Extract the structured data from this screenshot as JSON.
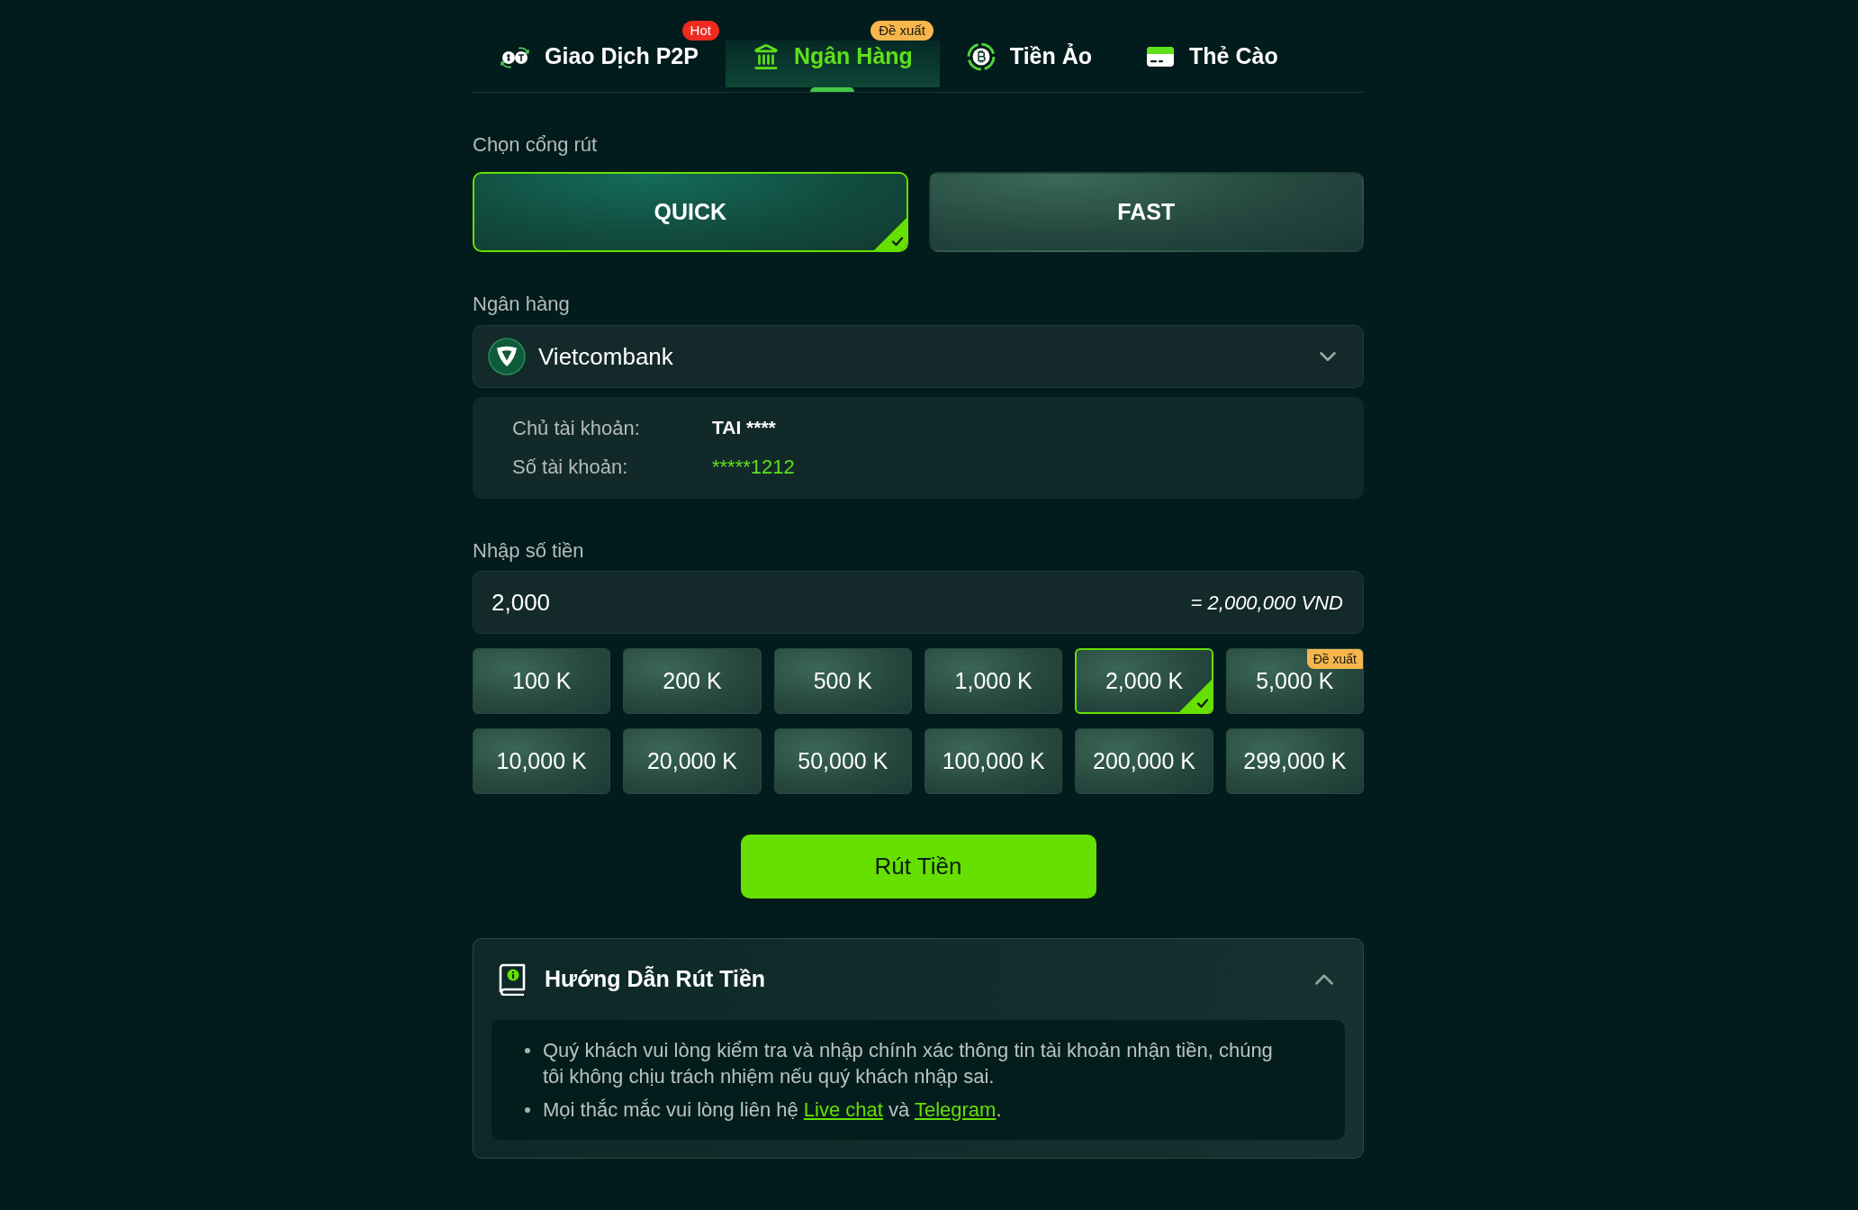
{
  "tabs": [
    {
      "label": "Giao Dịch P2P",
      "selected": false,
      "badge": {
        "text": "Hot",
        "color": "#ef2a1f"
      }
    },
    {
      "label": "Ngân Hàng",
      "selected": true,
      "badge": {
        "text": "Đề xuất",
        "color": "#f7b64d"
      }
    },
    {
      "label": "Tiền Ảo",
      "selected": false
    },
    {
      "label": "Thẻ Cào",
      "selected": false
    }
  ],
  "withdraw_gate": {
    "label": "Chọn cổng rút",
    "options": [
      {
        "label": "QUICK",
        "selected": true
      },
      {
        "label": "FAST",
        "selected": false
      }
    ]
  },
  "bank": {
    "label": "Ngân hàng",
    "value": "Vietcombank"
  },
  "account_info": [
    {
      "label": "Chủ tài khoản:",
      "value": "TAI ****",
      "kind": "plain"
    },
    {
      "label": "Số tài khoản:",
      "value": "*****1212",
      "kind": "accent"
    }
  ],
  "amount": {
    "label": "Nhập số tiền",
    "value": "2,000",
    "conversion": "= 2,000,000 VND"
  },
  "presets": [
    {
      "label": "100 K",
      "selected": false
    },
    {
      "label": "200 K",
      "selected": false
    },
    {
      "label": "500 K",
      "selected": false
    },
    {
      "label": "1,000 K",
      "selected": false
    },
    {
      "label": "2,000 K",
      "selected": true
    },
    {
      "label": "5,000 K",
      "selected": false,
      "badge": "Đề xuất"
    },
    {
      "label": "10,000 K",
      "selected": false
    },
    {
      "label": "20,000 K",
      "selected": false
    },
    {
      "label": "50,000 K",
      "selected": false
    },
    {
      "label": "100,000 K",
      "selected": false
    },
    {
      "label": "200,000 K",
      "selected": false
    },
    {
      "label": "299,000 K",
      "selected": false
    }
  ],
  "submit_button": {
    "label": "Rút Tiền"
  },
  "guide": {
    "title": "Hướng Dẫn Rút Tiền",
    "expanded": true,
    "items": [
      {
        "parts": [
          {
            "kind": "text",
            "text": "Quý khách vui lòng kiểm tra và nhập chính xác thông tin tài khoản nhận tiền, chúng tôi không chịu trách nhiệm nếu quý khách nhập sai."
          }
        ]
      },
      {
        "parts": [
          {
            "kind": "text",
            "text": "Mọi thắc mắc vui lòng liên hệ "
          },
          {
            "kind": "link",
            "text": "Live chat"
          },
          {
            "kind": "text",
            "text": " và "
          },
          {
            "kind": "link",
            "text": "Telegram"
          },
          {
            "kind": "text",
            "text": "."
          }
        ]
      }
    ]
  }
}
